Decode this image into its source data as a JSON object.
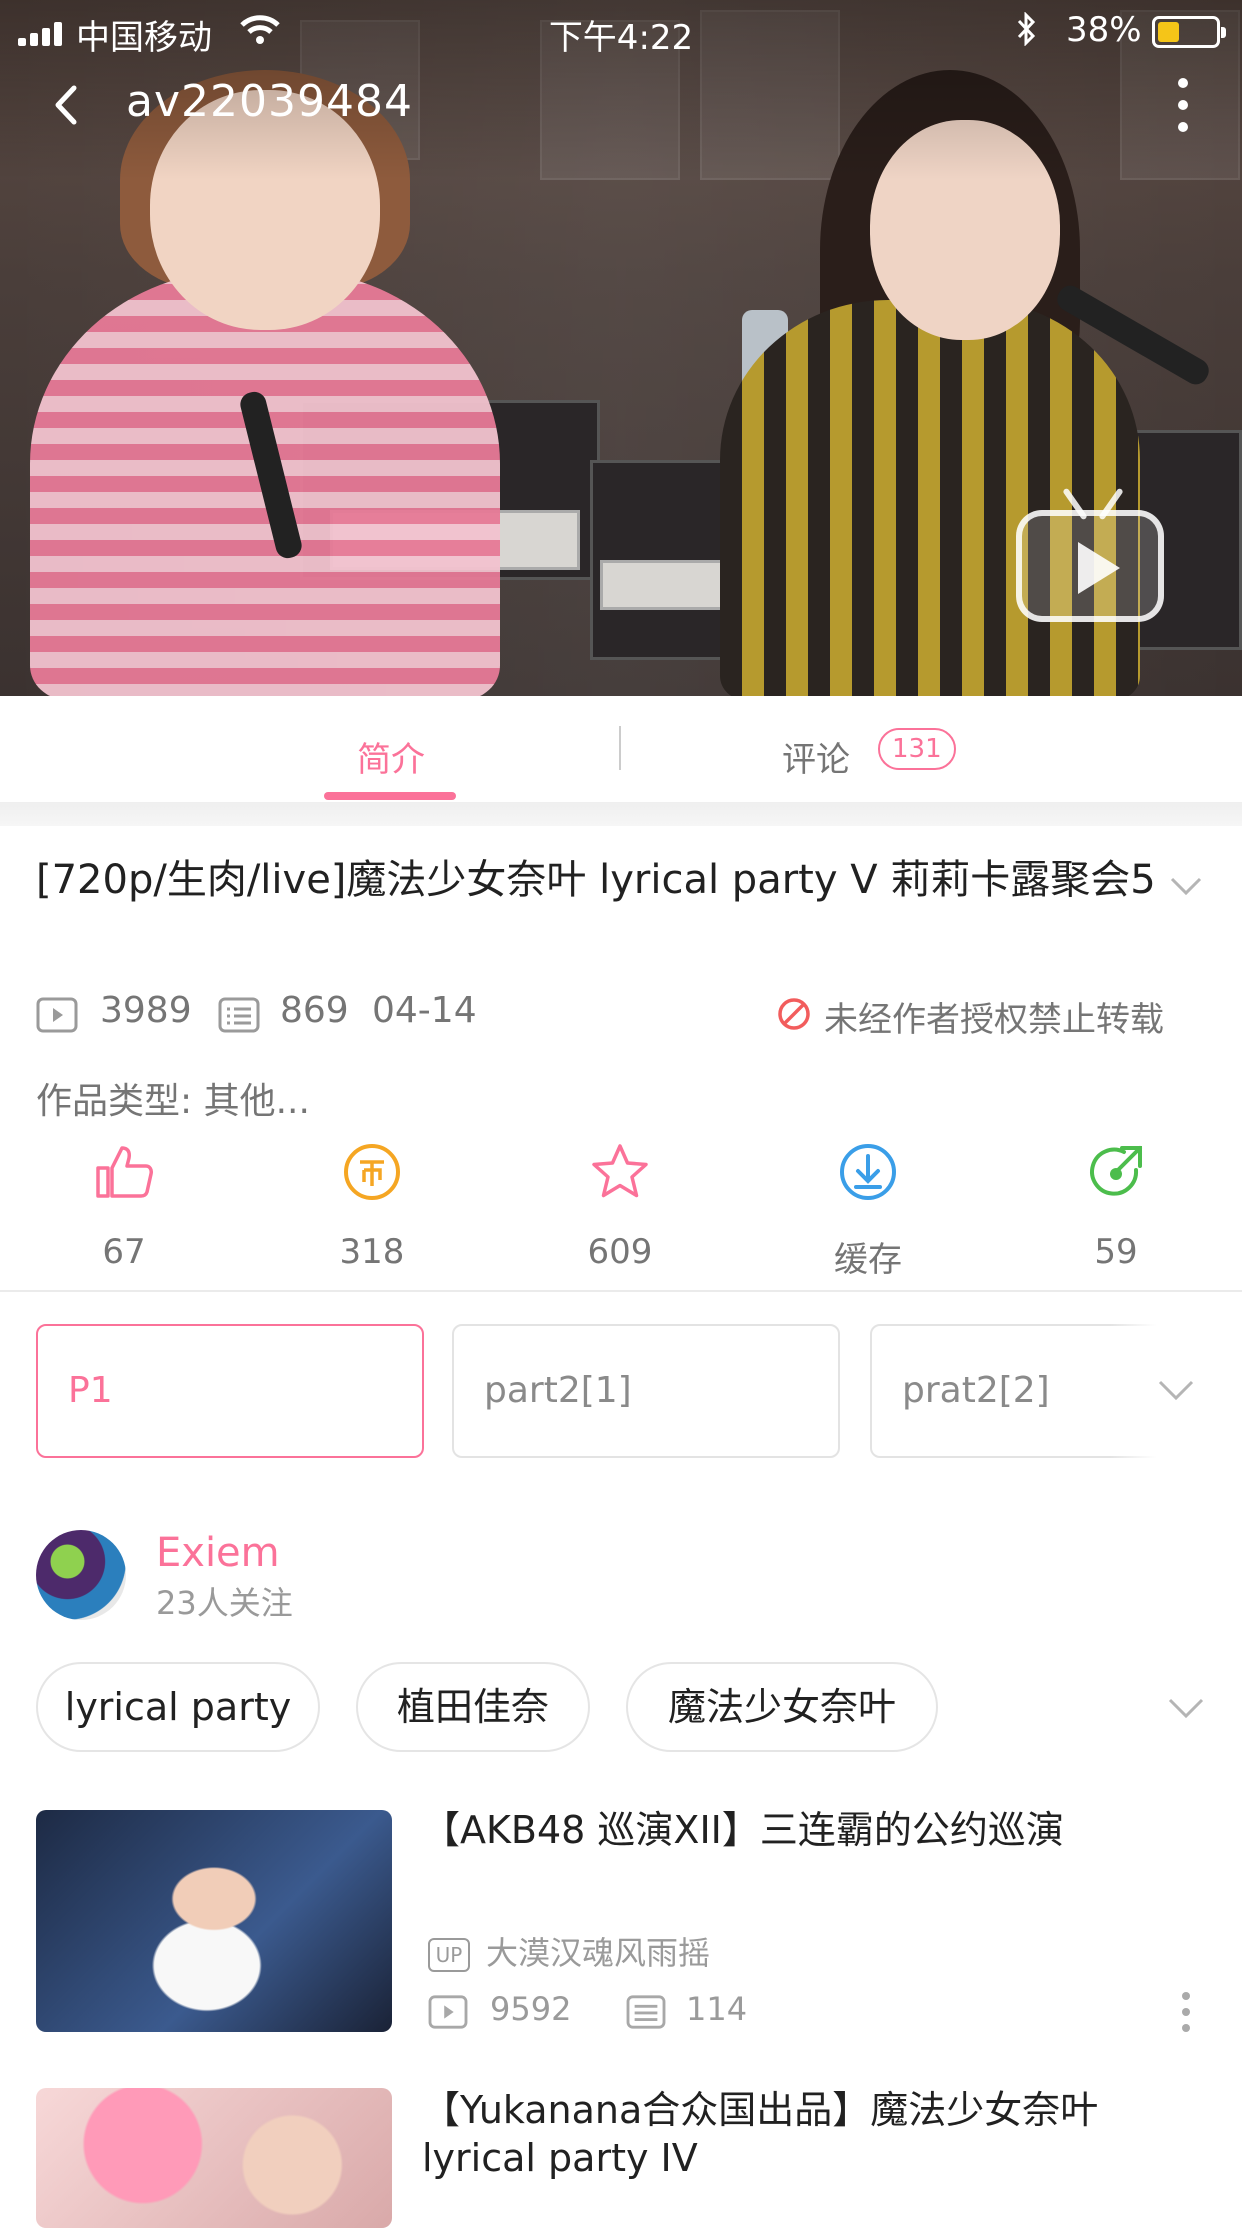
{
  "status_bar": {
    "carrier": "中国移动",
    "time": "下午4:22",
    "battery_percent": "38%",
    "battery_level": 0.38
  },
  "nav": {
    "title": "av22039484"
  },
  "tabs": {
    "intro": "简介",
    "comments": "评论",
    "comments_count": "131"
  },
  "video": {
    "title": "[720p/生肉/live]魔法少女奈叶 lyrical party V 莉莉卡露聚会5",
    "plays": "3989",
    "danmaku": "869",
    "date": "04-14",
    "no_repost": "未经作者授权禁止转载",
    "category": "作品类型: 其他..."
  },
  "actions": {
    "like": "67",
    "coin": "318",
    "favorite": "609",
    "cache": "缓存",
    "share": "59"
  },
  "colors": {
    "accent": "#fb7299",
    "coin": "#f5a623",
    "cache": "#3a9ee8",
    "share": "#4cbd4c"
  },
  "parts": [
    "P1",
    "part2[1]",
    "prat2[2]"
  ],
  "uploader": {
    "name": "Exiem",
    "followers": "23人关注"
  },
  "tags": [
    "lyrical party",
    "植田佳奈",
    "魔法少女奈叶"
  ],
  "recommended": [
    {
      "title": "【AKB48 巡演XII】三连霸的公约巡演",
      "badge": "UP",
      "uploader": "大漠汉魂风雨摇",
      "plays": "9592",
      "danmaku": "114"
    },
    {
      "title": "【Yukanana合众国出品】魔法少女奈叶 lyrical party IV"
    }
  ]
}
